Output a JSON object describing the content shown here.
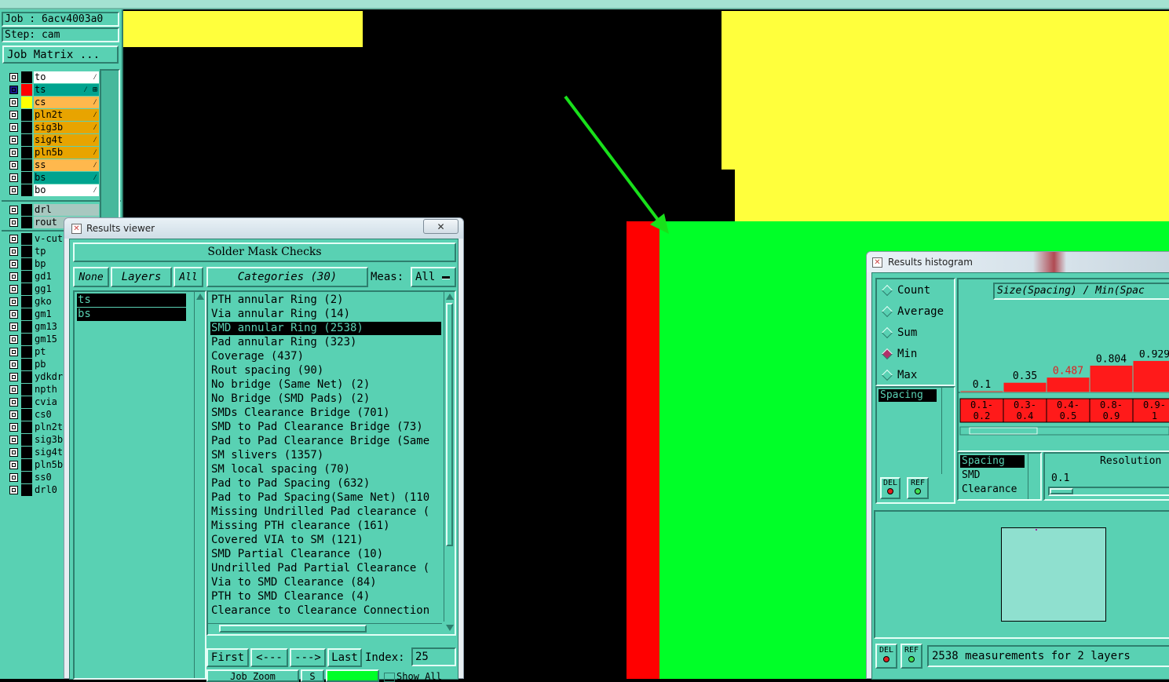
{
  "canvas": {
    "colors": {
      "background": "#000000",
      "yellow": "#ffff3c",
      "red": "#ff0000",
      "green": "#00ff28",
      "arrow": "#19e01b"
    }
  },
  "left_panel": {
    "job": "Job : 6acv4003a0",
    "step": "Step: cam",
    "job_matrix_button": "Job Matrix ...",
    "board_layers": [
      {
        "name": "to",
        "color": "#ffffff",
        "swatch": "#000000",
        "mark": "⁄"
      },
      {
        "name": "ts",
        "color": "#00a38f",
        "swatch": "#ff0000",
        "mark": "⁄ ⊞"
      },
      {
        "name": "cs",
        "color": "#ffb84d",
        "swatch": "#ffff00",
        "mark": "⁄"
      },
      {
        "name": "pln2t",
        "color": "#e8a400",
        "swatch": "#000000",
        "mark": "⁄"
      },
      {
        "name": "sig3b",
        "color": "#e8a400",
        "swatch": "#000000",
        "mark": "⁄"
      },
      {
        "name": "sig4t",
        "color": "#e8a400",
        "swatch": "#000000",
        "mark": "⁄"
      },
      {
        "name": "pln5b",
        "color": "#e8a400",
        "swatch": "#000000",
        "mark": "⁄"
      },
      {
        "name": "ss",
        "color": "#ffb84d",
        "swatch": "#000000",
        "mark": "⁄"
      },
      {
        "name": "bs",
        "color": "#00a38f",
        "swatch": "#000000",
        "mark": "⁄"
      },
      {
        "name": "bo",
        "color": "#ffffff",
        "swatch": "#000000",
        "mark": "⁄"
      }
    ],
    "drill_layers": [
      {
        "name": "drl",
        "color": "#a8c8c0",
        "swatch": "#000000"
      },
      {
        "name": "rout",
        "color": "#a8c8c0",
        "swatch": "#000000"
      }
    ],
    "misc_layers": [
      {
        "name": "v-cut"
      },
      {
        "name": "tp"
      },
      {
        "name": "bp"
      },
      {
        "name": "gd1"
      },
      {
        "name": "gg1"
      },
      {
        "name": "gko"
      },
      {
        "name": "gm1"
      },
      {
        "name": "gm13"
      },
      {
        "name": "gm15"
      },
      {
        "name": "pt"
      },
      {
        "name": "pb"
      },
      {
        "name": "ydkdrl"
      },
      {
        "name": "npth"
      },
      {
        "name": "cvia"
      },
      {
        "name": "cs0"
      },
      {
        "name": "pln2t0"
      },
      {
        "name": "sig3b0"
      },
      {
        "name": "sig4t0"
      },
      {
        "name": "pln5b0"
      },
      {
        "name": "ss0"
      },
      {
        "name": "drl0"
      }
    ]
  },
  "results_viewer": {
    "window_title": "Results viewer",
    "close_glyph": "✕",
    "heading": "Solder Mask Checks",
    "none_button": "None",
    "layers_label": "Layers",
    "all_button": "All",
    "categories_label": "Categories (30)",
    "meas_label": "Meas:",
    "meas_value": "All",
    "layers": [
      "ts",
      "bs"
    ],
    "categories": [
      "PTH annular Ring (2)",
      "Via annular Ring (14)",
      "SMD annular Ring (2538)",
      "Pad annular Ring (323)",
      "Coverage (437)",
      "Rout spacing (90)",
      "No bridge (Same Net) (2)",
      "No Bridge (SMD Pads) (2)",
      "SMDs Clearance Bridge (701)",
      "SMD to Pad Clearance Bridge (73)",
      "Pad to Pad Clearance Bridge (Same",
      "SM slivers (1357)",
      "SM local spacing (70)",
      "Pad to Pad Spacing (632)",
      "Pad to Pad Spacing(Same Net) (110",
      "Missing Undrilled Pad clearance (",
      "Missing PTH clearance (161)",
      "Covered VIA to SM (121)",
      "SMD Partial Clearance (10)",
      "Undrilled Pad Partial Clearance (",
      "Via to SMD Clearance (84)",
      "PTH to SMD Clearance (4)",
      "Clearance to Clearance Connection"
    ],
    "selected_category_index": 2,
    "first_button": "First",
    "prev_button": "<---",
    "next_button": "--->",
    "last_button": "Last",
    "index_label": "Index:",
    "index_value": "25",
    "bottom_button": "Job Zoom",
    "bottom_small": "S",
    "show_all_label": "Show All"
  },
  "histogram": {
    "window_title": "Results histogram",
    "modes": [
      {
        "label": "Count",
        "selected": false
      },
      {
        "label": "Average",
        "selected": false
      },
      {
        "label": "Sum",
        "selected": false
      },
      {
        "label": "Min",
        "selected": true
      },
      {
        "label": "Max",
        "selected": false
      }
    ],
    "list_item": "Spacing",
    "del_label": "DEL",
    "ref_label": "REF",
    "chart_title": "Size(Spacing) / Min(Spac",
    "chart_data": {
      "type": "bar",
      "categories": [
        "0.1-\n0.2",
        "0.3-\n0.4",
        "0.4-\n0.5",
        "0.8-\n0.9",
        "0.9-\n1"
      ],
      "values": [
        0.1,
        0.35,
        0.487,
        0.804,
        0.929
      ],
      "value_labels": [
        "0.1",
        "0.35",
        "0.487",
        "0.804",
        "0.929"
      ],
      "highlight_index": 2,
      "ylim": [
        0,
        1
      ]
    },
    "bin_labels_top": [
      "0.1-",
      "0.3-",
      "0.4-",
      "0.8-",
      "0.9-"
    ],
    "bin_labels_bottom": [
      "0.2",
      "0.4",
      "0.5",
      "0.9",
      "1"
    ],
    "selector_items": [
      "Spacing",
      "SMD",
      "Clearance"
    ],
    "resolution_label": "Resolution",
    "resolution_value": "0.1",
    "status": "2538 measurements for 2 layers"
  }
}
